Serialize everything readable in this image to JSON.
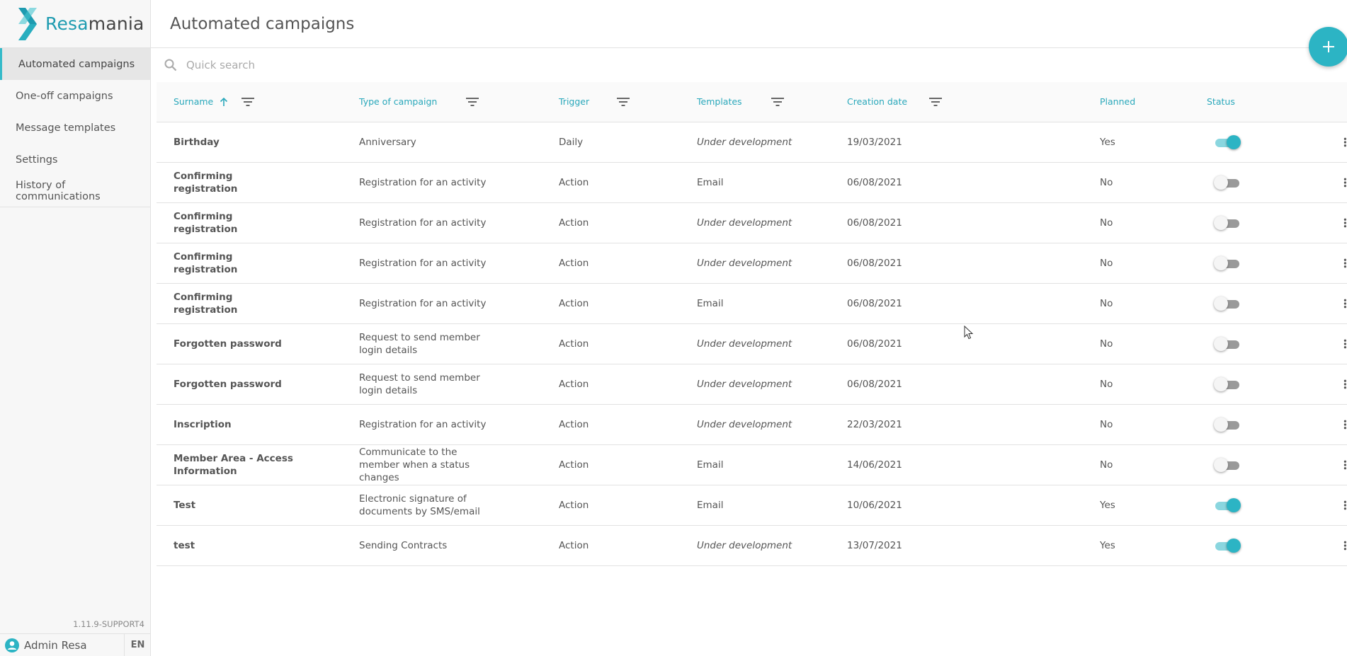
{
  "brand": {
    "name_part1": "Resa",
    "name_part2": "mania",
    "accent": "#2cb4c4"
  },
  "sidebar": {
    "items": [
      {
        "label": "Automated campaigns",
        "active": true
      },
      {
        "label": "One-off campaigns",
        "active": false
      },
      {
        "label": "Message templates",
        "active": false
      },
      {
        "label": "Settings",
        "active": false
      },
      {
        "label": "History of communications",
        "active": false
      }
    ],
    "version": "1.11.9-SUPPORT4",
    "user_name": "Admin Resa",
    "language": "EN"
  },
  "header": {
    "title": "Automated campaigns"
  },
  "search": {
    "placeholder": "Quick search"
  },
  "table": {
    "columns": [
      "Surname",
      "Type of campaign",
      "Trigger",
      "Templates",
      "Creation date",
      "Planned",
      "Status"
    ],
    "rows": [
      {
        "surname": "Birthday",
        "type": "Anniversary",
        "trigger": "Daily",
        "template": "Under development",
        "date": "19/03/2021",
        "planned": "Yes",
        "status": true
      },
      {
        "surname": "Confirming registration",
        "type": "Registration for an activity",
        "trigger": "Action",
        "template": "Email",
        "date": "06/08/2021",
        "planned": "No",
        "status": false
      },
      {
        "surname": "Confirming registration",
        "type": "Registration for an activity",
        "trigger": "Action",
        "template": "Under development",
        "date": "06/08/2021",
        "planned": "No",
        "status": false
      },
      {
        "surname": "Confirming registration",
        "type": "Registration for an activity",
        "trigger": "Action",
        "template": "Under development",
        "date": "06/08/2021",
        "planned": "No",
        "status": false
      },
      {
        "surname": "Confirming registration",
        "type": "Registration for an activity",
        "trigger": "Action",
        "template": "Email",
        "date": "06/08/2021",
        "planned": "No",
        "status": false
      },
      {
        "surname": "Forgotten password",
        "type": "Request to send member login details",
        "trigger": "Action",
        "template": "Under development",
        "date": "06/08/2021",
        "planned": "No",
        "status": false
      },
      {
        "surname": "Forgotten password",
        "type": "Request to send member login details",
        "trigger": "Action",
        "template": "Under development",
        "date": "06/08/2021",
        "planned": "No",
        "status": false
      },
      {
        "surname": "Inscription",
        "type": "Registration for an activity",
        "trigger": "Action",
        "template": "Under development",
        "date": "22/03/2021",
        "planned": "No",
        "status": false
      },
      {
        "surname": "Member Area - Access Information",
        "type": "Communicate to the member when a status changes",
        "trigger": "Action",
        "template": "Email",
        "date": "14/06/2021",
        "planned": "No",
        "status": false
      },
      {
        "surname": "Test",
        "type": "Electronic signature of documents by SMS/email",
        "trigger": "Action",
        "template": "Email",
        "date": "10/06/2021",
        "planned": "Yes",
        "status": true
      },
      {
        "surname": "test",
        "type": "Sending Contracts",
        "trigger": "Action",
        "template": "Under development",
        "date": "13/07/2021",
        "planned": "Yes",
        "status": true
      }
    ]
  }
}
